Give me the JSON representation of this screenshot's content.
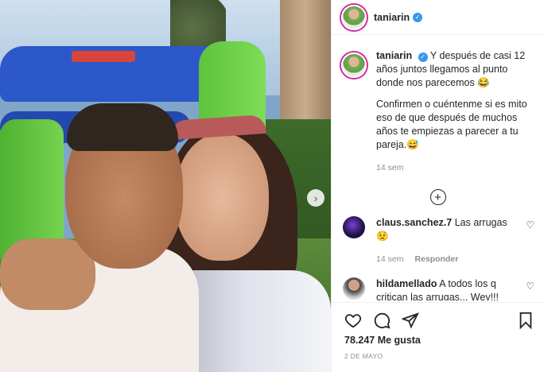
{
  "account": {
    "username": "taniarin"
  },
  "caption": {
    "username": "taniarin",
    "text_1": "Y después de casi 12 años juntos llegamos al punto donde nos parecemos 😂",
    "text_2": "Confirmen o cuéntenme si es mito eso de que después de muchos años te empiezas a parecer a tu pareja.😅",
    "time": "14 sem"
  },
  "comments": [
    {
      "username": "claus.sanchez.7",
      "text": "Las arrugas 😟",
      "time": "14 sem",
      "reply": "Responder"
    },
    {
      "username": "hildamellado",
      "text": "A todos los q critican las arrugas... Wey!!! Cuando la gente es feliz ríe un"
    }
  ],
  "post": {
    "likes": "78.247 Me gusta",
    "date": "2 DE MAYO"
  },
  "icons": [
    "verified-icon",
    "next-arrow-icon",
    "load-more-plus-icon",
    "heart-icon",
    "comment-icon",
    "share-icon",
    "bookmark-icon"
  ],
  "colors": {
    "verified": "#3897f0",
    "story_ring": "#d6249f",
    "meta_gray": "#8e8e8e"
  }
}
